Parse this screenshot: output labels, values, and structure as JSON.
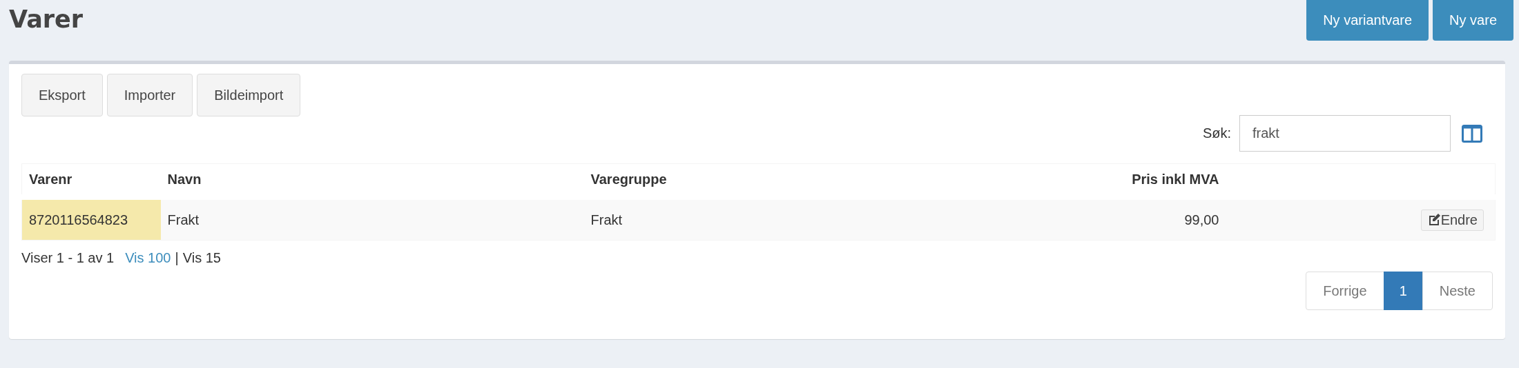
{
  "page_title": "Varer",
  "header_buttons": [
    "Ny variantvare",
    "Ny vare"
  ],
  "toolbar_buttons": [
    "Eksport",
    "Importer",
    "Bildeimport"
  ],
  "search": {
    "label": "Søk:",
    "value": "frakt"
  },
  "table": {
    "columns": [
      "Varenr",
      "Navn",
      "Varegruppe",
      "Pris inkl MVA"
    ],
    "rows": [
      {
        "cells": [
          {
            "text": "8720116564823",
            "highlighted": true
          },
          {
            "text": "Frakt",
            "highlighted": false
          },
          {
            "text": "Frakt",
            "highlighted": false
          },
          {
            "text": "99,00",
            "highlighted": false
          }
        ],
        "action": "Endre"
      }
    ]
  },
  "footer": {
    "info": "Viser 1 - 1 av 1",
    "link": "Vis 100",
    "separator": "|",
    "alt": "Vis 15"
  },
  "pagination": [
    {
      "label": "Forrige",
      "selected": false
    },
    {
      "label": "1",
      "selected": true
    },
    {
      "label": "Neste",
      "selected": false
    }
  ]
}
